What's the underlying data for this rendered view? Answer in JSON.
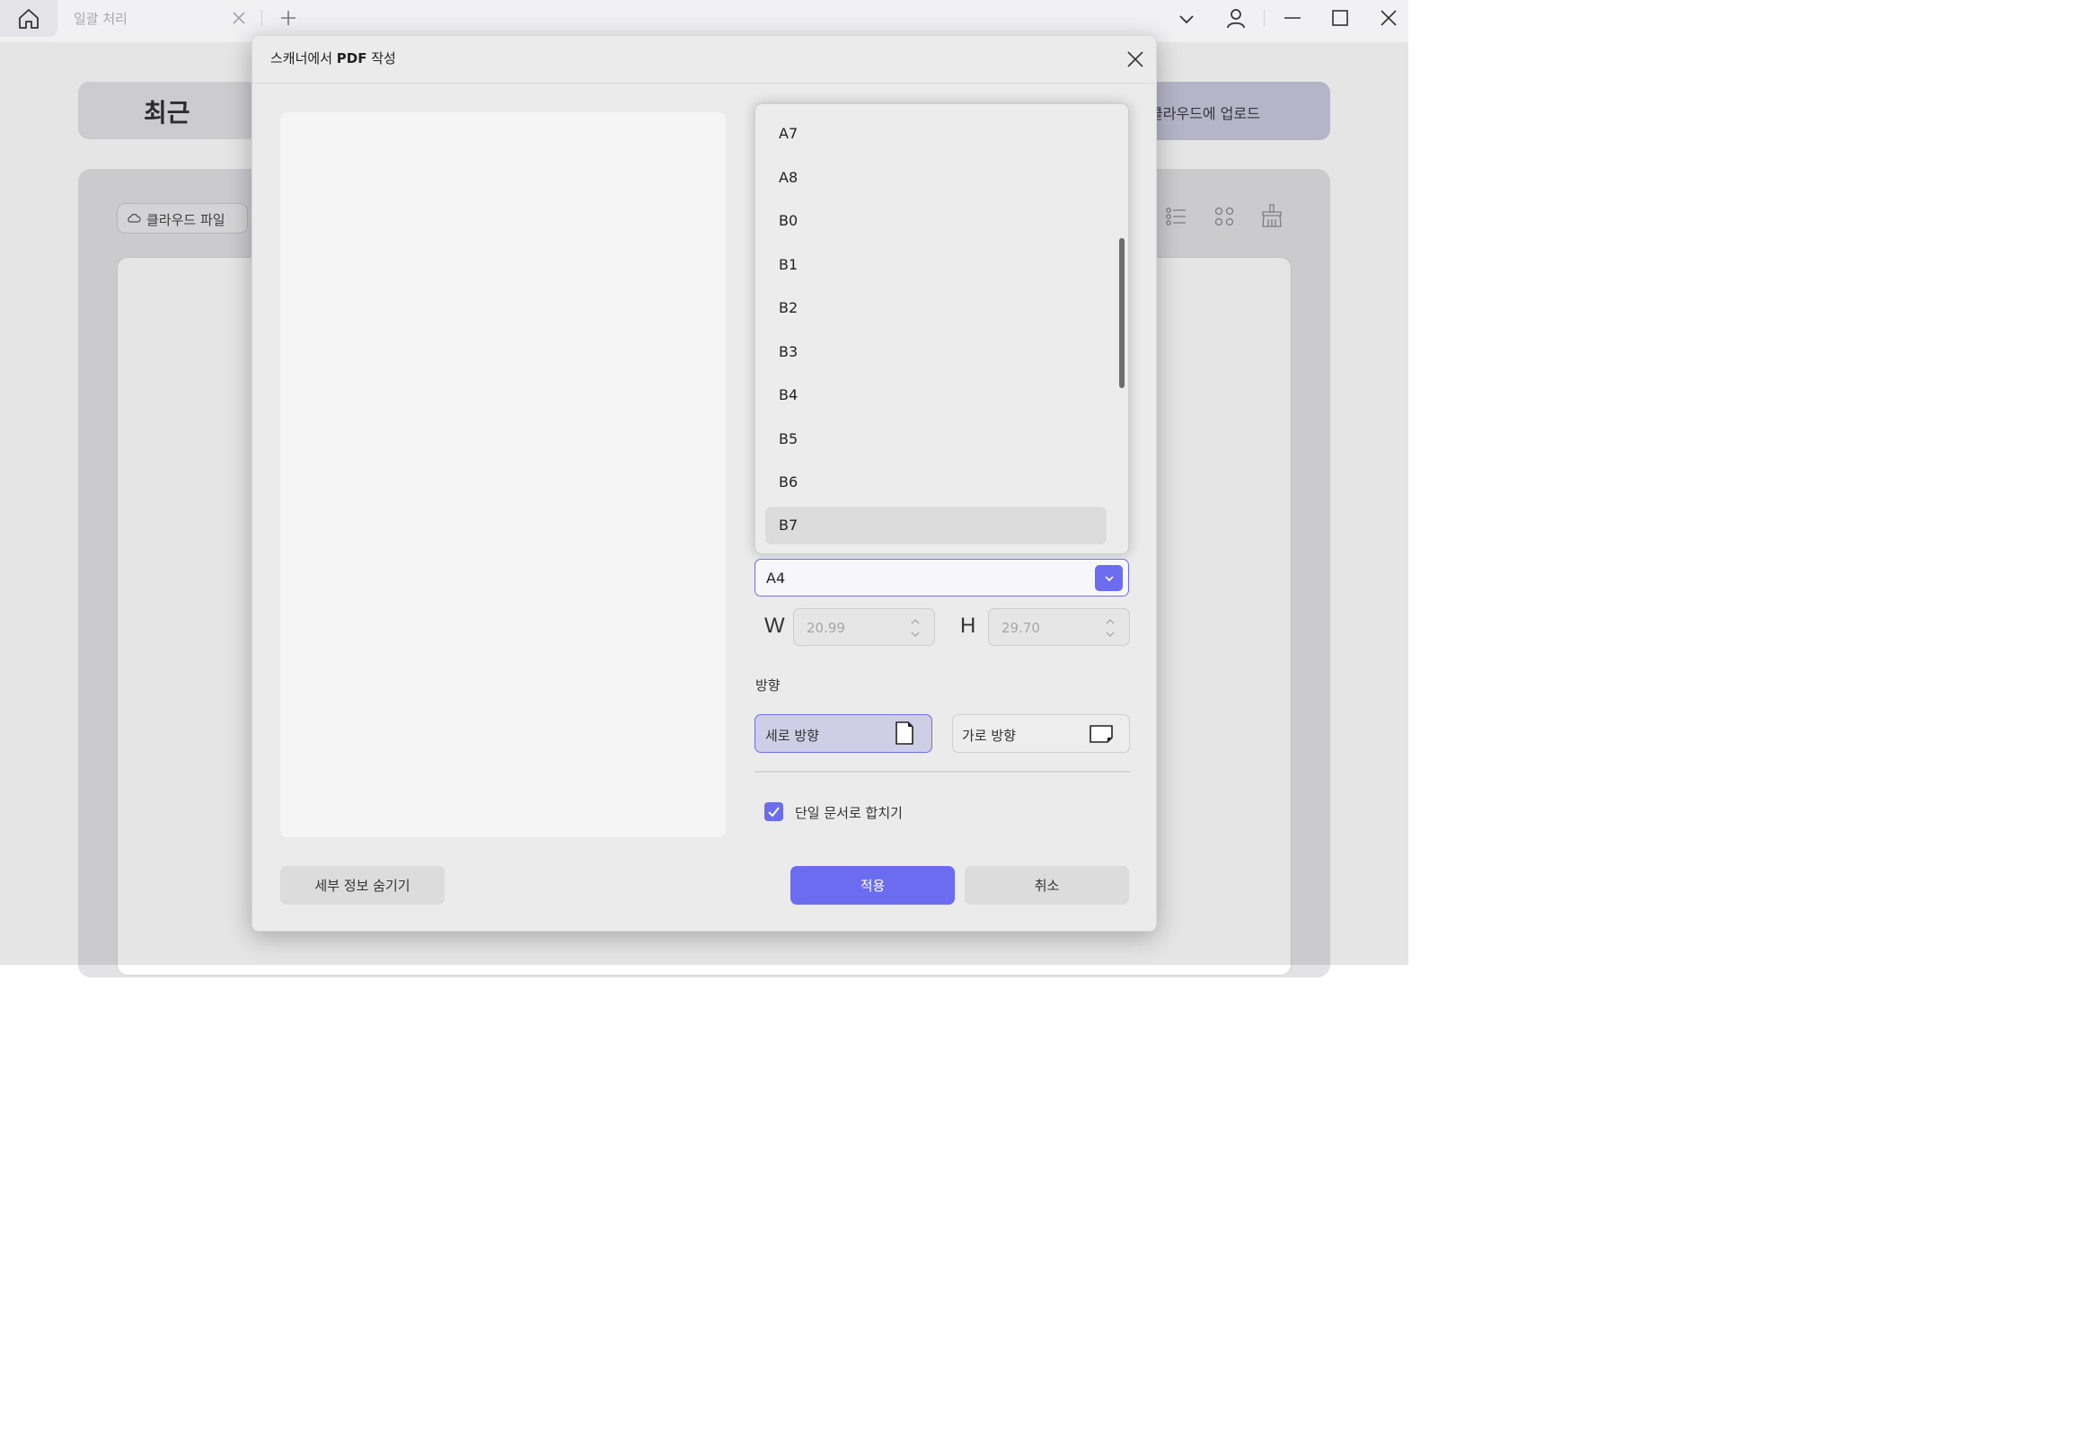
{
  "titlebar": {
    "tab_label": "일괄 처리",
    "icons": [
      "home-icon",
      "close-icon",
      "plus-icon",
      "chevron-down-icon",
      "user-icon",
      "minimize-icon",
      "maximize-icon",
      "close-icon"
    ]
  },
  "background": {
    "recent_label": "최근",
    "upload_label": "클라우드에 업로드",
    "cloud_files_label": "클라우드 파일"
  },
  "dialog": {
    "title_prefix": "스캐너에서 ",
    "title_bold": "PDF",
    "title_suffix": " 작성",
    "paper_sizes": [
      "A7",
      "A8",
      "B0",
      "B1",
      "B2",
      "B3",
      "B4",
      "B5",
      "B6",
      "B7"
    ],
    "highlighted_size": "B7",
    "selected_size": "A4",
    "width_label": "W",
    "width_value": "20.99",
    "height_label": "H",
    "height_value": "29.70",
    "orientation_label": "방향",
    "portrait_label": "세로 방향",
    "landscape_label": "가로 방향",
    "selected_orientation": "portrait",
    "merge_label": "단일 문서로 합치기",
    "merge_checked": true,
    "hide_details_label": "세부 정보 숨기기",
    "apply_label": "적용",
    "cancel_label": "취소"
  },
  "colors": {
    "accent": "#6b6cf0",
    "selected_orientation_bg": "#cecee6",
    "dialog_bg": "#ebebeb"
  }
}
